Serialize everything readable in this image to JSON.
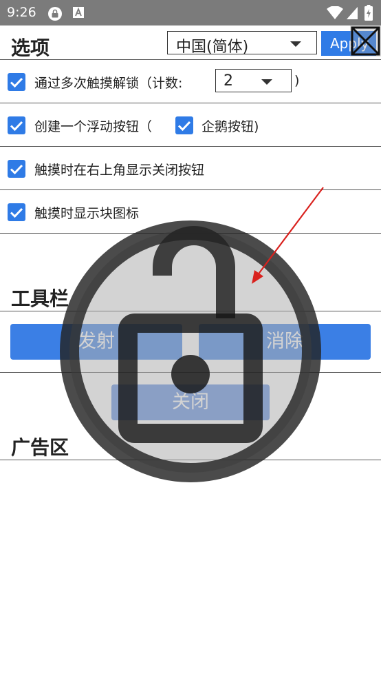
{
  "status_bar": {
    "time": "9:26"
  },
  "header": {
    "title": "选项",
    "language_select": {
      "value": "中国(简体)"
    },
    "apply_label": "Apply"
  },
  "options": {
    "multi_touch_unlock": {
      "label": "通过多次触摸解锁（计数:",
      "count": "2",
      "suffix": ")",
      "checked": true
    },
    "floating_button": {
      "label": "创建一个浮动按钮（",
      "checked": true
    },
    "penguin_button": {
      "label": "企鹅按钮)",
      "checked": true
    },
    "show_close_top_right": {
      "label": "触摸时在右上角显示关闭按钮",
      "checked": true
    },
    "show_block_icon": {
      "label": "触摸时显示块图标",
      "checked": true
    }
  },
  "toolbar": {
    "title": "工具栏",
    "fire_label": "发射",
    "clear_label": "消除",
    "close_label": "关闭"
  },
  "ads": {
    "title": "广告区"
  },
  "colors": {
    "accent": "#2f7be6",
    "status_bar": "#7b7b7b",
    "arrow": "#d9211d"
  }
}
